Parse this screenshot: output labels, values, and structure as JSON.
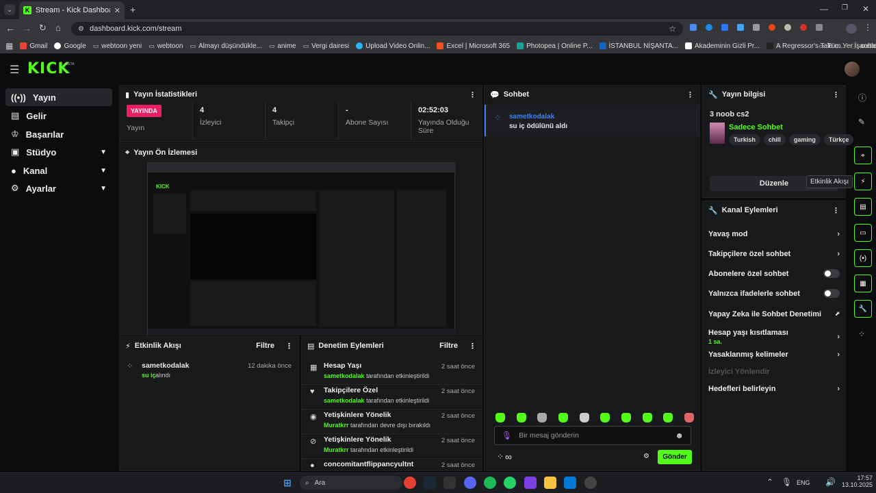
{
  "browser": {
    "tab_title": "Stream - Kick Dashboard",
    "url": "dashboard.kick.com/stream",
    "bookmarks": [
      "Gmail",
      "Google",
      "webtoon yeni",
      "webtoon",
      "Almayı düşündükle...",
      "anime",
      "Vergi dairesi",
      "Upload Video Onlin...",
      "Excel | Microsoft 365",
      "Photopea | Online P...",
      "İSTANBUL NİŞANTA...",
      "Akademinin Gizli Pr...",
      "A Regressor's Tale o...",
      "cobalt"
    ],
    "all_bookmarks": "Tüm Yer İşaretleri"
  },
  "app": {
    "logo": "KICK",
    "beta": "BETA"
  },
  "sidebar": {
    "items": [
      {
        "label": "Yayın"
      },
      {
        "label": "Gelir"
      },
      {
        "label": "Başarılar"
      },
      {
        "label": "Stüdyo"
      },
      {
        "label": "Kanal"
      },
      {
        "label": "Ayarlar"
      }
    ]
  },
  "stats": {
    "title": "Yayın İstatistikleri",
    "live_badge": "YAYINDA",
    "live_label": "Yayın",
    "viewers_value": "4",
    "viewers_label": "İzleyici",
    "followers_value": "4",
    "followers_label": "Takipçi",
    "subs_value": "-",
    "subs_label": "Abone Sayısı",
    "uptime_value": "02:52:03",
    "uptime_label": "Yayında Olduğu Süre"
  },
  "preview": {
    "title": "Yayın Ön İzlemesi"
  },
  "activity": {
    "title": "Etkinlik Akışı",
    "filter": "Filtre",
    "items": [
      {
        "user": "sametkodalak",
        "highlight": "su iç",
        "action": "alındı",
        "time": "12 dakika önce"
      }
    ]
  },
  "moderation": {
    "title": "Denetim Eylemleri",
    "filter": "Filtre",
    "items": [
      {
        "title": "Hesap Yaşı",
        "user": "sametkodalak",
        "action": "tarafından etkinleştirildi",
        "time": "2 saat önce"
      },
      {
        "title": "Takipçilere Özel",
        "user": "sametkodalak",
        "action": "tarafından etkinleştirildi",
        "time": "2 saat önce"
      },
      {
        "title": "Yetişkinlere Yönelik",
        "user": "Muratkrr",
        "action": "tarafından devre dışı bırakıldı",
        "time": "2 saat önce"
      },
      {
        "title": "Yetişkinlere Yönelik",
        "user": "Muratkrr",
        "action": "tarafından etkinleştirildi",
        "time": "2 saat önce"
      },
      {
        "title": "concomitantflippancyultnt",
        "user": "",
        "action": "",
        "time": "2 saat önce"
      }
    ]
  },
  "chat": {
    "title": "Sohbet",
    "message_user": "sametkodalak",
    "message_text": "su iç ödülünü aldı",
    "input_placeholder": "Bir mesaj gönderin",
    "send_label": "Gönder",
    "infinity": "∞"
  },
  "stream_info": {
    "title": "Yayın bilgisi",
    "stream_title": "3 noob cs2",
    "category": "Sadece Sohbet",
    "tags": [
      "Turkish",
      "chill",
      "gaming",
      "Türkçe"
    ],
    "edit_label": "Düzenle",
    "tooltip": "Etkinlik Akışı"
  },
  "channel_actions": {
    "title": "Kanal Eylemleri",
    "items": [
      {
        "label": "Yavaş mod",
        "control": "chevron"
      },
      {
        "label": "Takipçilere özel sohbet",
        "control": "chevron"
      },
      {
        "label": "Abonelere özel sohbet",
        "control": "toggle"
      },
      {
        "label": "Yalnızca ifadelerle sohbet",
        "control": "toggle"
      },
      {
        "label": "Yapay Zeka ile Sohbet Denetimi",
        "control": "chart"
      },
      {
        "label": "Hesap yaşı kısıtlaması",
        "sub": "1 sa.",
        "control": "chevron"
      },
      {
        "label": "Yasaklanmış kelimeler",
        "control": "chevron"
      },
      {
        "label": "İzleyici Yönlendir",
        "control": "none",
        "disabled": true
      },
      {
        "label": "Hedefleri belirleyin",
        "control": "chevron"
      }
    ]
  },
  "taskbar": {
    "search": "Ara",
    "lang": "ENG",
    "time": "17:57",
    "date": "13.10.2025"
  },
  "colors": {
    "accent": "#53fc18",
    "live": "#e91e63",
    "panel": "#18191b"
  }
}
